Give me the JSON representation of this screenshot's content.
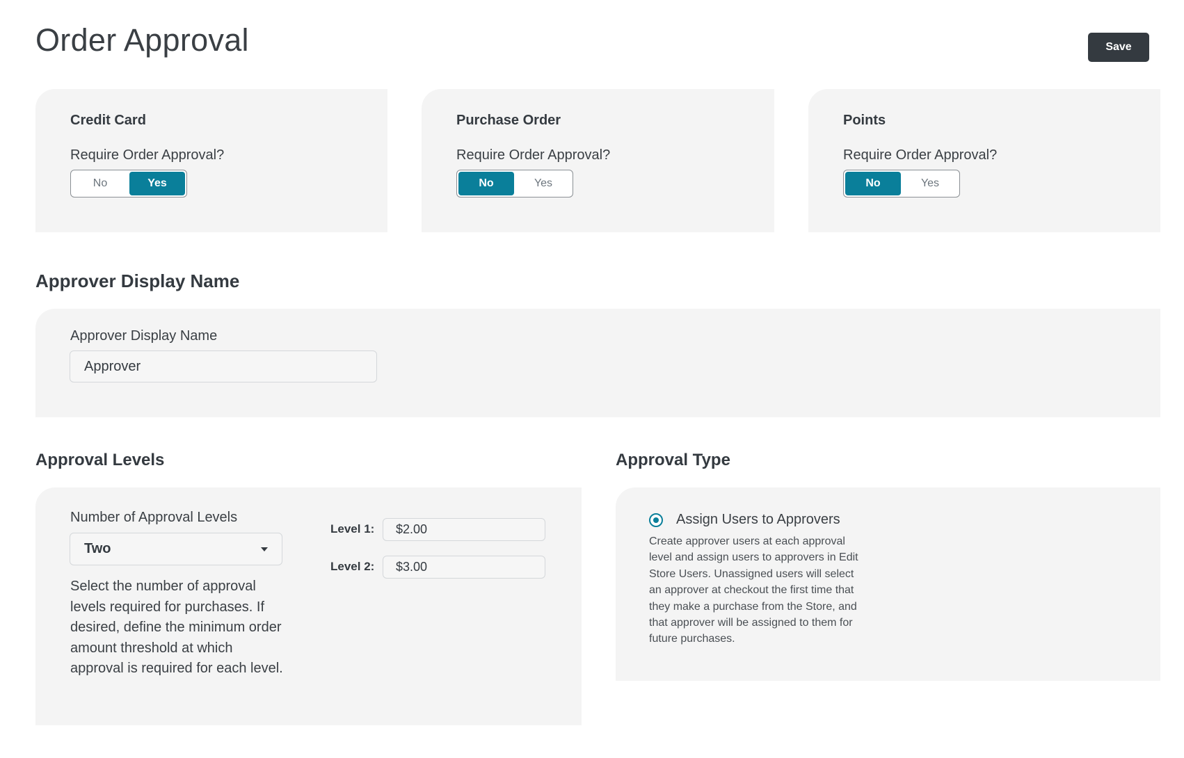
{
  "page": {
    "title": "Order Approval",
    "save_label": "Save"
  },
  "payment_methods": [
    {
      "title": "Credit Card",
      "question": "Require Order Approval?",
      "no_label": "No",
      "yes_label": "Yes",
      "selected": "Yes"
    },
    {
      "title": "Purchase Order",
      "question": "Require Order Approval?",
      "no_label": "No",
      "yes_label": "Yes",
      "selected": "No"
    },
    {
      "title": "Points",
      "question": "Require Order Approval?",
      "no_label": "No",
      "yes_label": "Yes",
      "selected": "No"
    }
  ],
  "approver_display": {
    "section_title": "Approver Display Name",
    "field_label": "Approver Display Name",
    "value": "Approver"
  },
  "approval_levels": {
    "section_title": "Approval Levels",
    "field_label": "Number of Approval Levels",
    "selected": "Two",
    "help_lines": [
      "Select the number of approval",
      "levels required for purchases. If",
      "desired, define the minimum order",
      "amount threshold at which",
      "approval is required for each level."
    ],
    "levels": [
      {
        "label": "Level 1:",
        "value": "$2.00"
      },
      {
        "label": "Level 2:",
        "value": "$3.00"
      }
    ]
  },
  "approval_type": {
    "section_title": "Approval Type",
    "option_label": "Assign Users to Approvers",
    "selected": true,
    "description_lines": [
      "Create approver users at each approval",
      "level and assign users to approvers in Edit",
      "Store Users. Unassigned users will select",
      "an approver at checkout the first time that",
      "they make a purchase from the Store, and",
      "that approver will be assigned to them for",
      "future purchases."
    ]
  },
  "colors": {
    "accent": "#0a7f9a",
    "save_button": "#343a40",
    "card_background": "#f4f4f4"
  }
}
